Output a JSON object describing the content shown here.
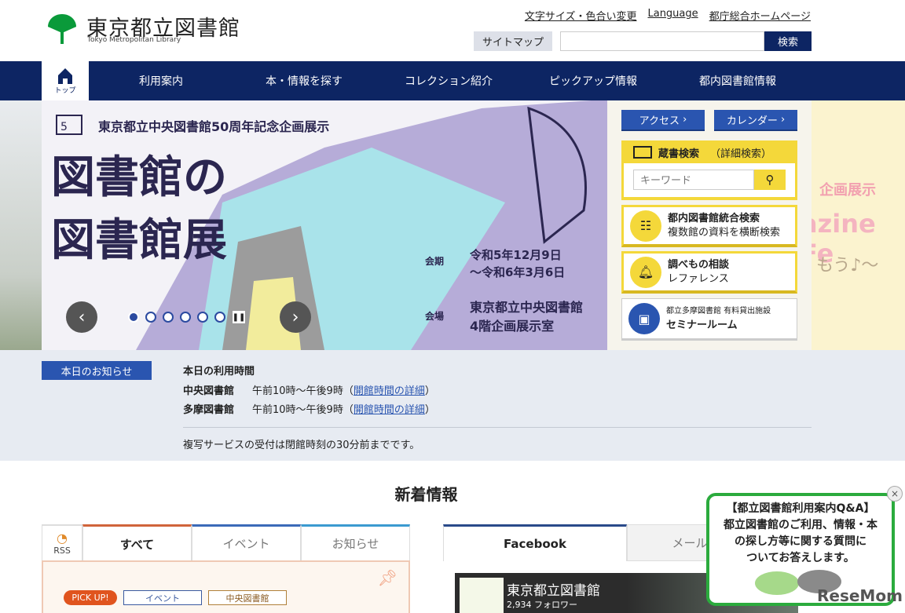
{
  "header": {
    "logo_title": "東京都立図書館",
    "logo_subtitle": "Tokyo Metropolitan Library",
    "links": [
      "文字サイズ・色合い変更",
      "Language",
      "都庁総合ホームページ"
    ],
    "sitemap": "サイトマップ",
    "search_button": "検索"
  },
  "nav": {
    "home": "トップ",
    "items": [
      "利用案内",
      "本・情報を探す",
      "コレクション紹介",
      "ピックアップ情報",
      "都内図書館情報"
    ]
  },
  "hero": {
    "subtitle": "東京都立中央図書館50周年記念企画展示",
    "title_line1": "図書館の",
    "title_line2": "図書館展",
    "period_label": "会期",
    "period": [
      "令和5年12月9日",
      "〜令和6年3月6日"
    ],
    "venue_label": "会場",
    "venue": [
      "東京都立中央図書館",
      "4階企画展示室"
    ],
    "peek_text1": "企画展示",
    "peek_text2": "azine Fe",
    "peek_text3": "もう♪〜",
    "slides": 6
  },
  "side": {
    "access": "アクセス",
    "calendar": "カレンダー",
    "catalog_title": "蔵書検索",
    "catalog_detail": "詳細検索",
    "keyword_placeholder": "キーワード",
    "box1_title": "都内図書館統合検索",
    "box1_sub": "複数館の資料を横断検索",
    "box2_title": "調べもの相談",
    "box2_sub": "レファレンス",
    "box3_small": "都立多摩図書館 有料貸出施設",
    "box3_title": "セミナールーム"
  },
  "notice": {
    "badge": "本日のお知らせ",
    "heading": "本日の利用時間",
    "rows": [
      {
        "name": "中央図書館",
        "hours": "午前10時〜午後9時",
        "link": "開館時間の詳細"
      },
      {
        "name": "多摩図書館",
        "hours": "午前10時〜午後9時",
        "link": "開館時間の詳細"
      }
    ],
    "note": "複写サービスの受付は閉館時刻の30分前までです。"
  },
  "news": {
    "title": "新着情報",
    "rss": "RSS",
    "tabs": [
      "すべて",
      "イベント",
      "お知らせ"
    ],
    "tags": [
      "PICK UP!",
      "イベント",
      "中央図書館"
    ]
  },
  "social": {
    "tabs": [
      "Facebook",
      "メール"
    ],
    "page_name": "東京都立図書館",
    "followers": "2,934 フォロワー"
  },
  "qa": {
    "title": "【都立図書館利用案内Q&A】",
    "body": [
      "都立図書館のご利用、情報・本",
      "の探し方等に関する質問に",
      "ついてお答えします。"
    ],
    "close": "×"
  },
  "watermark": "ReseMom"
}
